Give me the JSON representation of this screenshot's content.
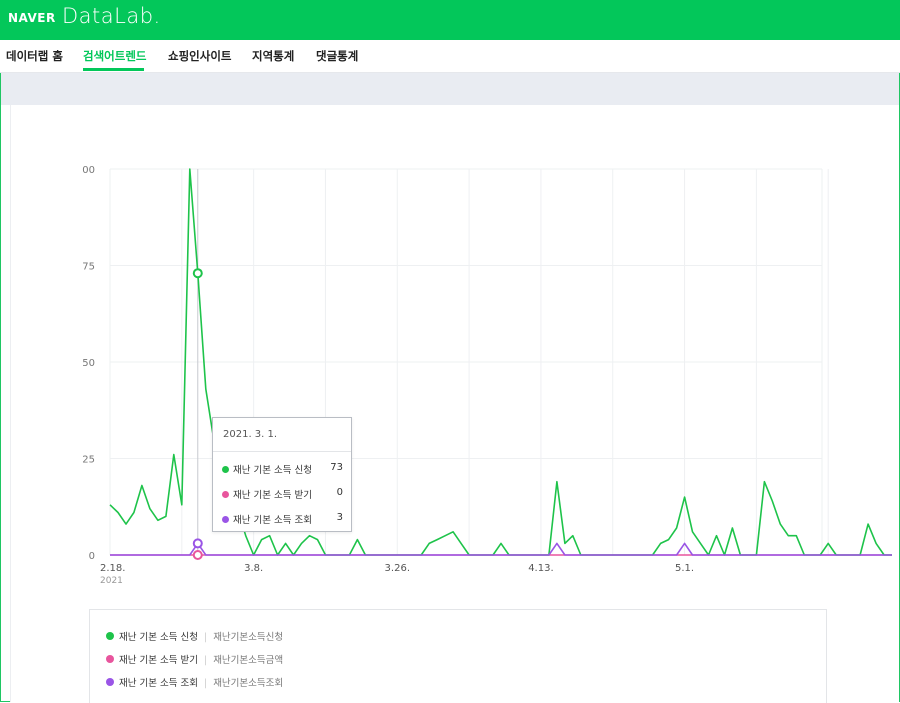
{
  "header": {
    "brand": "NAVER",
    "product": "DataLab."
  },
  "nav": {
    "items": [
      {
        "label": "데이터랩 홈",
        "active": false
      },
      {
        "label": "검색어트렌드",
        "active": true
      },
      {
        "label": "쇼핑인사이트",
        "active": false
      },
      {
        "label": "지역통계",
        "active": false
      },
      {
        "label": "댓글통계",
        "active": false
      }
    ]
  },
  "colors": {
    "brand": "#03c75a",
    "series_1": "#1ec34a",
    "series_2": "#e8559d",
    "series_3": "#9a55e6"
  },
  "tooltip": {
    "date": "2021. 3. 1.",
    "rows": [
      {
        "name": "재난 기본 소득 신청",
        "value": "73",
        "color": "#1ec34a"
      },
      {
        "name": "재난 기본 소득 받기",
        "value": "0",
        "color": "#e8559d"
      },
      {
        "name": "재난 기본 소득 조회",
        "value": "3",
        "color": "#9a55e6"
      }
    ]
  },
  "legend": {
    "items": [
      {
        "name": "재난 기본 소득 신청",
        "keywords": "재난기본소득신청",
        "color": "#1ec34a"
      },
      {
        "name": "재난 기본 소득 받기",
        "keywords": "재난기본소득금액",
        "color": "#e8559d"
      },
      {
        "name": "재난 기본 소득 조회",
        "keywords": "재난기본소득조회",
        "color": "#9a55e6"
      }
    ]
  },
  "chart_data": {
    "type": "line",
    "x_start": "2021-02-18",
    "x_tick_labels": [
      {
        "label": "2.18.",
        "sublabel": "2021",
        "date": "2021-02-18"
      },
      {
        "label": "3.8.",
        "sublabel": "",
        "date": "2021-03-08"
      },
      {
        "label": "3.26.",
        "sublabel": "",
        "date": "2021-03-26"
      },
      {
        "label": "4.13.",
        "sublabel": "",
        "date": "2021-04-13"
      },
      {
        "label": "5.1.",
        "sublabel": "",
        "date": "2021-05-01"
      }
    ],
    "y_tick_labels": [
      "00",
      "75",
      "50",
      "25",
      "0"
    ],
    "y_tick_values": [
      100,
      75,
      50,
      25,
      0
    ],
    "ylim": [
      0,
      100
    ],
    "grid": true,
    "highlight_date": "2021-03-01",
    "series": [
      {
        "name": "재난 기본 소득 신청",
        "color": "#1ec34a",
        "values": [
          13,
          11,
          8,
          11,
          18,
          12,
          9,
          10,
          26,
          13,
          100,
          73,
          43,
          30,
          24,
          18,
          12,
          5,
          0,
          4,
          5,
          0,
          3,
          0,
          3,
          5,
          4,
          0,
          0,
          0,
          0,
          4,
          0,
          0,
          0,
          0,
          0,
          0,
          0,
          0,
          3,
          4,
          5,
          6,
          3,
          0,
          0,
          0,
          0,
          3,
          0,
          0,
          0,
          0,
          0,
          0,
          19,
          3,
          5,
          0,
          0,
          0,
          0,
          0,
          0,
          0,
          0,
          0,
          0,
          3,
          4,
          7,
          15,
          6,
          3,
          0,
          5,
          0,
          7,
          0,
          0,
          0,
          19,
          14,
          8,
          5,
          5,
          0,
          0,
          0,
          3,
          0,
          0,
          0,
          0,
          8,
          3,
          0,
          0
        ]
      },
      {
        "name": "재난 기본 소득 받기",
        "color": "#e8559d",
        "values": [
          0,
          0,
          0,
          0,
          0,
          0,
          0,
          0,
          0,
          0,
          0,
          0,
          0,
          0,
          0,
          0,
          0,
          0,
          0,
          0,
          0,
          0,
          0,
          0,
          0,
          0,
          0,
          0,
          0,
          0,
          0,
          0,
          0,
          0,
          0,
          0,
          0,
          0,
          0,
          0,
          0,
          0,
          0,
          0,
          0,
          0,
          0,
          0,
          0,
          0,
          0,
          0,
          0,
          0,
          0,
          0,
          0,
          0,
          0,
          0,
          0,
          0,
          0,
          0,
          0,
          0,
          0,
          0,
          0,
          0,
          0,
          0,
          0,
          0,
          0,
          0,
          0,
          0,
          0,
          0,
          0,
          0,
          0,
          0,
          0,
          0,
          0,
          0,
          0,
          0,
          0,
          0,
          0,
          0,
          0,
          0,
          0,
          0,
          0
        ]
      },
      {
        "name": "재난 기본 소득 조회",
        "color": "#9a55e6",
        "values": [
          0,
          0,
          0,
          0,
          0,
          0,
          0,
          0,
          0,
          0,
          0,
          3,
          0,
          0,
          0,
          0,
          0,
          0,
          0,
          0,
          0,
          0,
          0,
          0,
          0,
          0,
          0,
          0,
          0,
          0,
          0,
          0,
          0,
          0,
          0,
          0,
          0,
          0,
          0,
          0,
          0,
          0,
          0,
          0,
          0,
          0,
          0,
          0,
          0,
          0,
          0,
          0,
          0,
          0,
          0,
          0,
          3,
          0,
          0,
          0,
          0,
          0,
          0,
          0,
          0,
          0,
          0,
          0,
          0,
          0,
          0,
          0,
          3,
          0,
          0,
          0,
          0,
          0,
          0,
          0,
          0,
          0,
          0,
          0,
          0,
          0,
          0,
          0,
          0,
          0,
          0,
          0,
          0,
          0,
          0,
          0,
          0,
          0,
          0
        ]
      }
    ]
  }
}
